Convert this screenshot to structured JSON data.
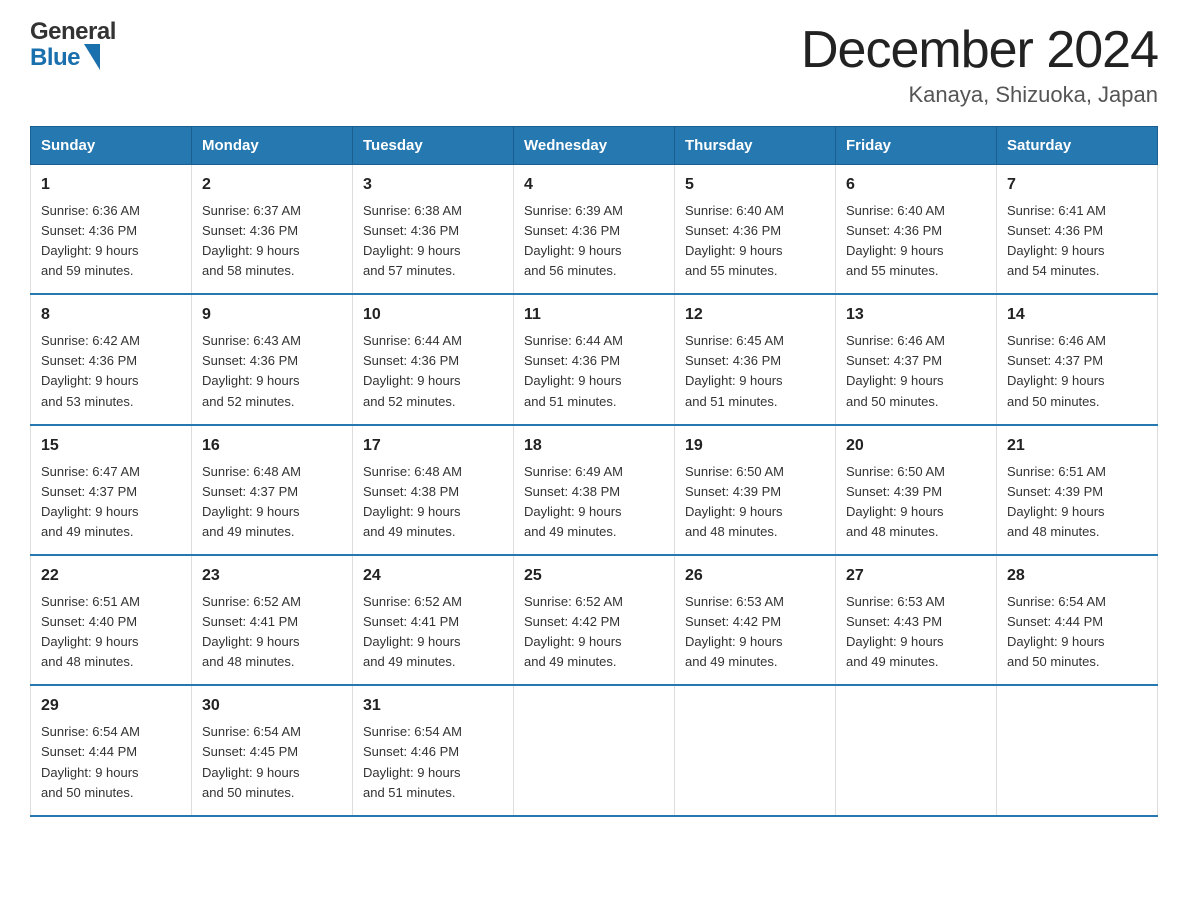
{
  "header": {
    "logo_general": "General",
    "logo_blue": "Blue",
    "month_title": "December 2024",
    "location": "Kanaya, Shizuoka, Japan"
  },
  "days_of_week": [
    "Sunday",
    "Monday",
    "Tuesday",
    "Wednesday",
    "Thursday",
    "Friday",
    "Saturday"
  ],
  "weeks": [
    [
      {
        "day": "1",
        "sunrise": "6:36 AM",
        "sunset": "4:36 PM",
        "daylight": "9 hours and 59 minutes."
      },
      {
        "day": "2",
        "sunrise": "6:37 AM",
        "sunset": "4:36 PM",
        "daylight": "9 hours and 58 minutes."
      },
      {
        "day": "3",
        "sunrise": "6:38 AM",
        "sunset": "4:36 PM",
        "daylight": "9 hours and 57 minutes."
      },
      {
        "day": "4",
        "sunrise": "6:39 AM",
        "sunset": "4:36 PM",
        "daylight": "9 hours and 56 minutes."
      },
      {
        "day": "5",
        "sunrise": "6:40 AM",
        "sunset": "4:36 PM",
        "daylight": "9 hours and 55 minutes."
      },
      {
        "day": "6",
        "sunrise": "6:40 AM",
        "sunset": "4:36 PM",
        "daylight": "9 hours and 55 minutes."
      },
      {
        "day": "7",
        "sunrise": "6:41 AM",
        "sunset": "4:36 PM",
        "daylight": "9 hours and 54 minutes."
      }
    ],
    [
      {
        "day": "8",
        "sunrise": "6:42 AM",
        "sunset": "4:36 PM",
        "daylight": "9 hours and 53 minutes."
      },
      {
        "day": "9",
        "sunrise": "6:43 AM",
        "sunset": "4:36 PM",
        "daylight": "9 hours and 52 minutes."
      },
      {
        "day": "10",
        "sunrise": "6:44 AM",
        "sunset": "4:36 PM",
        "daylight": "9 hours and 52 minutes."
      },
      {
        "day": "11",
        "sunrise": "6:44 AM",
        "sunset": "4:36 PM",
        "daylight": "9 hours and 51 minutes."
      },
      {
        "day": "12",
        "sunrise": "6:45 AM",
        "sunset": "4:36 PM",
        "daylight": "9 hours and 51 minutes."
      },
      {
        "day": "13",
        "sunrise": "6:46 AM",
        "sunset": "4:37 PM",
        "daylight": "9 hours and 50 minutes."
      },
      {
        "day": "14",
        "sunrise": "6:46 AM",
        "sunset": "4:37 PM",
        "daylight": "9 hours and 50 minutes."
      }
    ],
    [
      {
        "day": "15",
        "sunrise": "6:47 AM",
        "sunset": "4:37 PM",
        "daylight": "9 hours and 49 minutes."
      },
      {
        "day": "16",
        "sunrise": "6:48 AM",
        "sunset": "4:37 PM",
        "daylight": "9 hours and 49 minutes."
      },
      {
        "day": "17",
        "sunrise": "6:48 AM",
        "sunset": "4:38 PM",
        "daylight": "9 hours and 49 minutes."
      },
      {
        "day": "18",
        "sunrise": "6:49 AM",
        "sunset": "4:38 PM",
        "daylight": "9 hours and 49 minutes."
      },
      {
        "day": "19",
        "sunrise": "6:50 AM",
        "sunset": "4:39 PM",
        "daylight": "9 hours and 48 minutes."
      },
      {
        "day": "20",
        "sunrise": "6:50 AM",
        "sunset": "4:39 PM",
        "daylight": "9 hours and 48 minutes."
      },
      {
        "day": "21",
        "sunrise": "6:51 AM",
        "sunset": "4:39 PM",
        "daylight": "9 hours and 48 minutes."
      }
    ],
    [
      {
        "day": "22",
        "sunrise": "6:51 AM",
        "sunset": "4:40 PM",
        "daylight": "9 hours and 48 minutes."
      },
      {
        "day": "23",
        "sunrise": "6:52 AM",
        "sunset": "4:41 PM",
        "daylight": "9 hours and 48 minutes."
      },
      {
        "day": "24",
        "sunrise": "6:52 AM",
        "sunset": "4:41 PM",
        "daylight": "9 hours and 49 minutes."
      },
      {
        "day": "25",
        "sunrise": "6:52 AM",
        "sunset": "4:42 PM",
        "daylight": "9 hours and 49 minutes."
      },
      {
        "day": "26",
        "sunrise": "6:53 AM",
        "sunset": "4:42 PM",
        "daylight": "9 hours and 49 minutes."
      },
      {
        "day": "27",
        "sunrise": "6:53 AM",
        "sunset": "4:43 PM",
        "daylight": "9 hours and 49 minutes."
      },
      {
        "day": "28",
        "sunrise": "6:54 AM",
        "sunset": "4:44 PM",
        "daylight": "9 hours and 50 minutes."
      }
    ],
    [
      {
        "day": "29",
        "sunrise": "6:54 AM",
        "sunset": "4:44 PM",
        "daylight": "9 hours and 50 minutes."
      },
      {
        "day": "30",
        "sunrise": "6:54 AM",
        "sunset": "4:45 PM",
        "daylight": "9 hours and 50 minutes."
      },
      {
        "day": "31",
        "sunrise": "6:54 AM",
        "sunset": "4:46 PM",
        "daylight": "9 hours and 51 minutes."
      },
      null,
      null,
      null,
      null
    ]
  ],
  "labels": {
    "sunrise": "Sunrise:",
    "sunset": "Sunset:",
    "daylight": "Daylight:"
  }
}
